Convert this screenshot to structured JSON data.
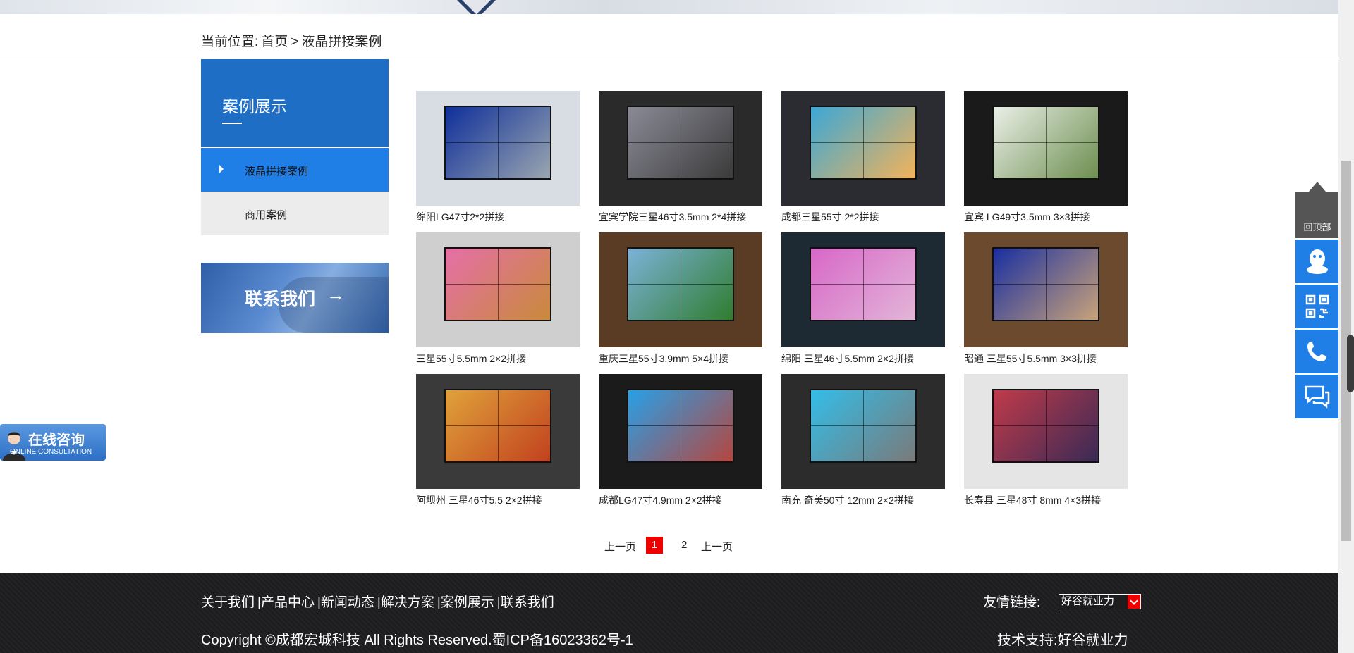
{
  "breadcrumb": {
    "prefix": "当前位置:",
    "home": "首页",
    "sep": ">",
    "current": "液晶拼接案例"
  },
  "sidebar": {
    "title": "案例展示",
    "items": [
      {
        "label": "液晶拼接案例",
        "active": true
      },
      {
        "label": "商用案例",
        "active": false
      }
    ],
    "contact_label": "联系我们",
    "contact_arrow": "→"
  },
  "cases": [
    {
      "caption": "绵阳LG47寸2*2拼接",
      "colors": [
        "#d8dde3",
        "#0f2f9a",
        "#9aa6b0"
      ]
    },
    {
      "caption": "宜宾学院三星46寸3.5mm 2*4拼接",
      "colors": [
        "#2a2a2a",
        "#8a8a96",
        "#3b3b3b"
      ]
    },
    {
      "caption": "成都三星55寸 2*2拼接",
      "colors": [
        "#2a2c31",
        "#3ca7d6",
        "#f2b35a"
      ]
    },
    {
      "caption": "宜宾 LG49寸3.5mm 3×3拼接",
      "colors": [
        "#1a1a1a",
        "#e9efe7",
        "#6d8e4f"
      ]
    },
    {
      "caption": "三星55寸5.5mm 2×2拼接",
      "colors": [
        "#cfcfcf",
        "#e56fa8",
        "#c98a3a"
      ]
    },
    {
      "caption": "重庆三星55寸3.9mm 5×4拼接",
      "colors": [
        "#5a3b24",
        "#7bb2d8",
        "#2f7d2f"
      ]
    },
    {
      "caption": "绵阳 三星46寸5.5mm 2×2拼接",
      "colors": [
        "#1d2a34",
        "#d868c8",
        "#e2b5d8"
      ]
    },
    {
      "caption": "昭通 三星55寸5.5mm 3×3拼接",
      "colors": [
        "#6b4a2e",
        "#1a2fa0",
        "#c8a27a"
      ]
    },
    {
      "caption": "阿坝州 三星46寸5.5 2×2拼接",
      "colors": [
        "#3a3a3a",
        "#e0a23a",
        "#c2411f"
      ]
    },
    {
      "caption": "成都LG47寸4.9mm 2×2拼接",
      "colors": [
        "#1b1b1b",
        "#27a0e8",
        "#b6463e"
      ]
    },
    {
      "caption": "南充 奇美50寸 12mm 2×2拼接",
      "colors": [
        "#2c2c2c",
        "#33bde8",
        "#7a7a7a"
      ]
    },
    {
      "caption": "长寿县 三星48寸 8mm 4×3拼接",
      "colors": [
        "#e5e5e5",
        "#c03a4a",
        "#3a2a55"
      ]
    }
  ],
  "pager": {
    "prev": "上一页",
    "current": "1",
    "page2": "2",
    "next": "上一页"
  },
  "footer": {
    "nav": [
      "关于我们",
      "|产品中心",
      "|新闻动态",
      "|解决方案",
      "|案例展示",
      "|联系我们"
    ],
    "links_label": "友情链接:",
    "links_selected": "好谷就业力",
    "copyright": "Copyright ©成都宏城科技 All Rights Reserved.蜀ICP备16023362号-1",
    "tech": "技术支持:好谷就业力"
  },
  "float_bar": {
    "top_label": "回顶部",
    "icons": [
      "qq-icon",
      "qrcode-icon",
      "phone-icon",
      "chat-icon"
    ]
  },
  "online": {
    "title": "在线咨询",
    "subtitle": "ONLINE CONSULTATION"
  },
  "colors": {
    "primary": "#1e6ec6",
    "active": "#1f7fe6",
    "footer": "#1d1d1f",
    "pager_current": "#ee0000"
  }
}
